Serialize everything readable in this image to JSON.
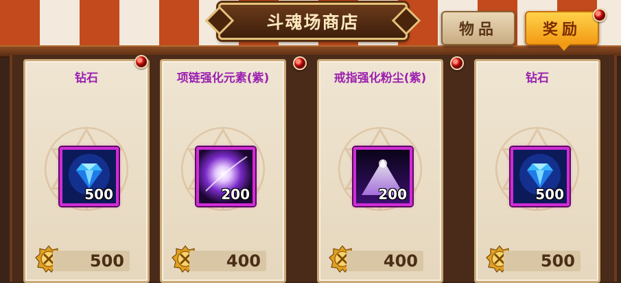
{
  "shop": {
    "title": "斗魂场商店",
    "tabs": [
      {
        "label": "物品",
        "active": false
      },
      {
        "label": "奖励",
        "active": true
      }
    ]
  },
  "items": [
    {
      "name": "钻石",
      "icon": "diamond-icon",
      "quantity": "500",
      "price": "500"
    },
    {
      "name": "项链强化元素(紫)",
      "icon": "purple-element-icon",
      "quantity": "200",
      "price": "400"
    },
    {
      "name": "戒指强化粉尘(紫)",
      "icon": "purple-dust-icon",
      "quantity": "200",
      "price": "400"
    },
    {
      "name": "钻石",
      "icon": "diamond-icon",
      "quantity": "500",
      "price": "500"
    }
  ],
  "colors": {
    "item_name": "#9b1fb0",
    "rarity_border": "#d02cd6",
    "active_tab": "#f39a14",
    "notification": "#d51a12"
  }
}
